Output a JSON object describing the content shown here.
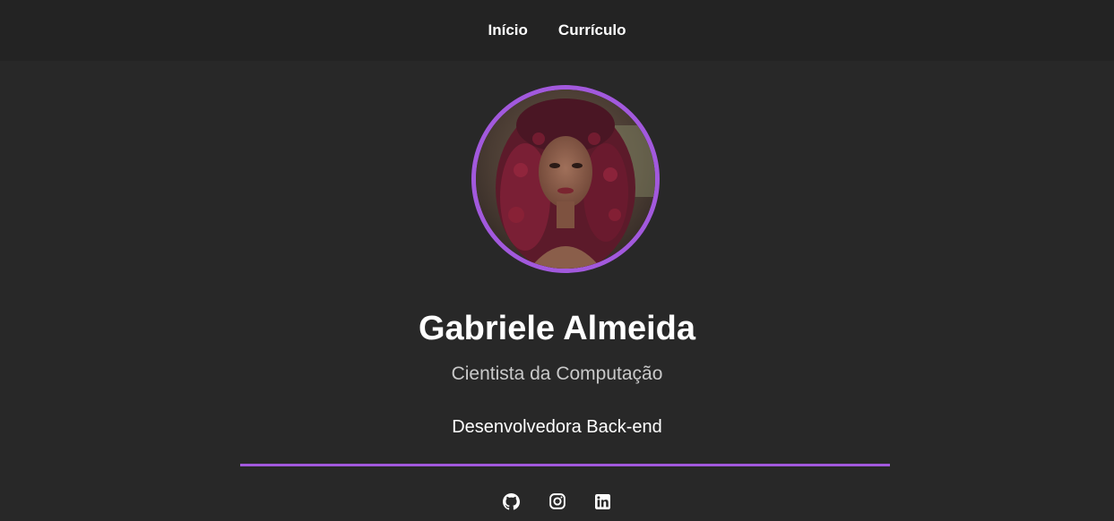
{
  "nav": {
    "items": [
      {
        "label": "Início"
      },
      {
        "label": "Currículo"
      }
    ]
  },
  "profile": {
    "photo_icon": "profile-photo",
    "name": "Gabriele Almeida",
    "title": "Cientista da Computação",
    "role": "Desenvolvedora Back-end"
  },
  "socials": [
    {
      "icon": "github-icon"
    },
    {
      "icon": "instagram-icon"
    },
    {
      "icon": "linkedin-icon"
    }
  ],
  "colors": {
    "background": "#282828",
    "navbar": "#232323",
    "accent": "#a259dd",
    "text": "#ffffff",
    "muted_text": "#c9c9c9"
  }
}
